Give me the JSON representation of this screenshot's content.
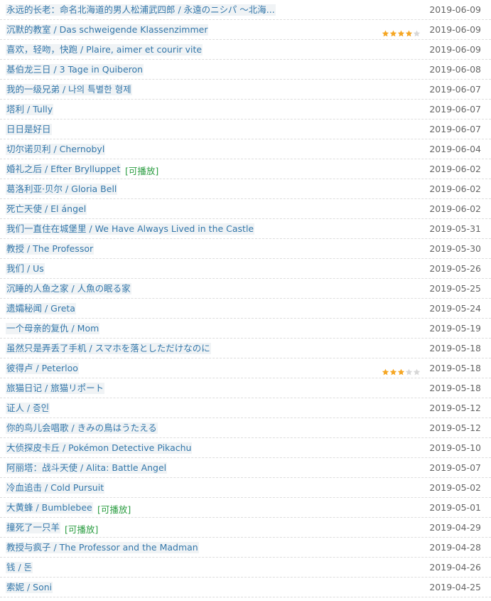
{
  "colors": {
    "link": "#3377aa",
    "playable": "#2a9c40",
    "star_on": "#f5a623",
    "star_off": "#d7d7d7"
  },
  "items": [
    {
      "title": "永远的长老：命名北海道的男人松浦武四郎 / 永遠のニシパ ～北海...",
      "date": "2019-06-09",
      "playable": "",
      "rating": 0
    },
    {
      "title": "沉默的教室 / Das schweigende Klassenzimmer",
      "date": "2019-06-09",
      "playable": "",
      "rating": 4
    },
    {
      "title": "喜欢，轻吻，快跑 / Plaire, aimer et courir vite",
      "date": "2019-06-09",
      "playable": "",
      "rating": 0
    },
    {
      "title": "基伯龙三日 / 3 Tage in Quiberon",
      "date": "2019-06-08",
      "playable": "",
      "rating": 0
    },
    {
      "title": "我的一级兄弟 / 나의 특별한 형제",
      "date": "2019-06-07",
      "playable": "",
      "rating": 0
    },
    {
      "title": "塔利 / Tully",
      "date": "2019-06-07",
      "playable": "",
      "rating": 0
    },
    {
      "title": "日日是好日",
      "date": "2019-06-07",
      "playable": "",
      "rating": 0
    },
    {
      "title": "切尔诺贝利 / Chernobyl",
      "date": "2019-06-04",
      "playable": "",
      "rating": 0
    },
    {
      "title": "婚礼之后 / Efter Brylluppet",
      "date": "2019-06-02",
      "playable": "[可播放]",
      "rating": 0
    },
    {
      "title": "葛洛利亚·贝尔 / Gloria Bell",
      "date": "2019-06-02",
      "playable": "",
      "rating": 0
    },
    {
      "title": "死亡天使 / El ángel",
      "date": "2019-06-02",
      "playable": "",
      "rating": 0
    },
    {
      "title": "我们一直住在城堡里 / We Have Always Lived in the Castle",
      "date": "2019-05-31",
      "playable": "",
      "rating": 0
    },
    {
      "title": "教授 / The Professor",
      "date": "2019-05-30",
      "playable": "",
      "rating": 0
    },
    {
      "title": "我们 / Us",
      "date": "2019-05-26",
      "playable": "",
      "rating": 0
    },
    {
      "title": "沉睡的人鱼之家 / 人魚の眠る家",
      "date": "2019-05-25",
      "playable": "",
      "rating": 0
    },
    {
      "title": "遗孀秘闻 / Greta",
      "date": "2019-05-24",
      "playable": "",
      "rating": 0
    },
    {
      "title": "一个母亲的复仇 / Mom",
      "date": "2019-05-19",
      "playable": "",
      "rating": 0
    },
    {
      "title": "虽然只是弄丢了手机 / スマホを落としただけなのに",
      "date": "2019-05-18",
      "playable": "",
      "rating": 0
    },
    {
      "title": "彼得卢 / Peterloo",
      "date": "2019-05-18",
      "playable": "",
      "rating": 3
    },
    {
      "title": "旅猫日记 / 旅猫リポート",
      "date": "2019-05-18",
      "playable": "",
      "rating": 0
    },
    {
      "title": "证人 / 증인",
      "date": "2019-05-12",
      "playable": "",
      "rating": 0
    },
    {
      "title": "你的鸟儿会唱歌 / きみの鳥はうたえる",
      "date": "2019-05-12",
      "playable": "",
      "rating": 0
    },
    {
      "title": "大侦探皮卡丘 / Pokémon Detective Pikachu",
      "date": "2019-05-10",
      "playable": "",
      "rating": 0
    },
    {
      "title": "阿丽塔：战斗天使 / Alita: Battle Angel",
      "date": "2019-05-07",
      "playable": "",
      "rating": 0
    },
    {
      "title": "冷血追击 / Cold Pursuit",
      "date": "2019-05-02",
      "playable": "",
      "rating": 0
    },
    {
      "title": "大黄蜂 / Bumblebee",
      "date": "2019-05-01",
      "playable": "[可播放]",
      "rating": 0
    },
    {
      "title": "撞死了一只羊",
      "date": "2019-04-29",
      "playable": "[可播放]",
      "rating": 0
    },
    {
      "title": "教授与疯子 / The Professor and the Madman",
      "date": "2019-04-28",
      "playable": "",
      "rating": 0
    },
    {
      "title": "钱 / 돈",
      "date": "2019-04-26",
      "playable": "",
      "rating": 0
    },
    {
      "title": "索妮 / Soni",
      "date": "2019-04-25",
      "playable": "",
      "rating": 0
    }
  ]
}
